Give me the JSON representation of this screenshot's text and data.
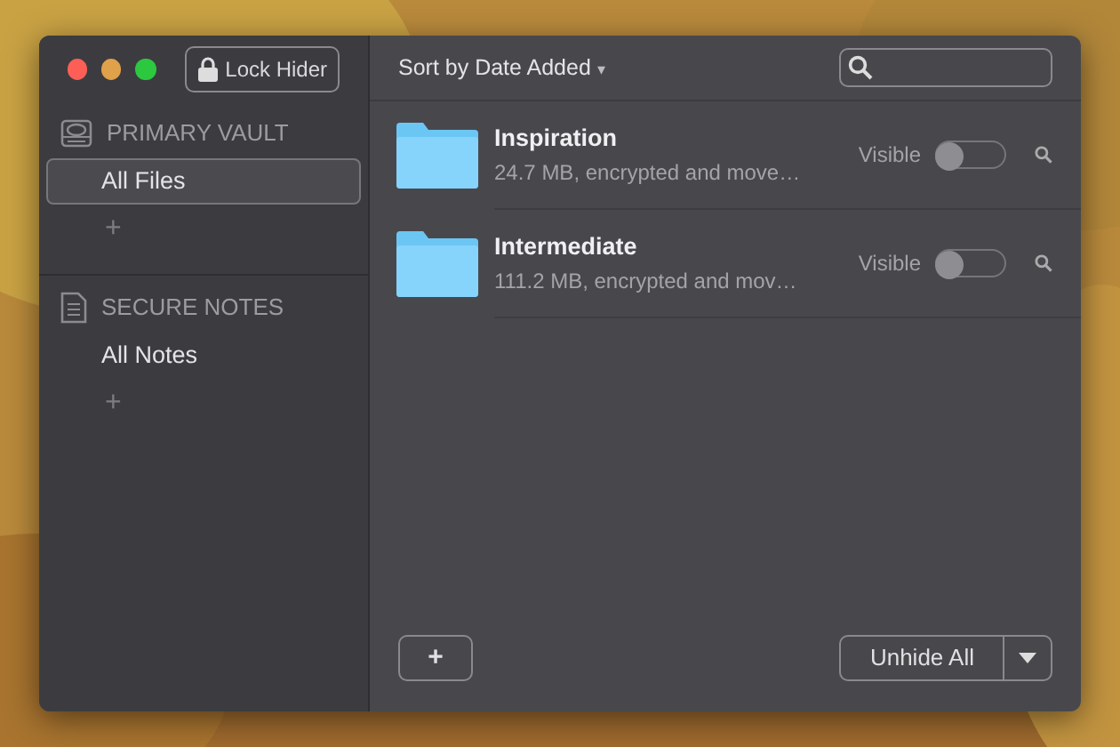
{
  "toolbar": {
    "lock_button": "Lock Hider",
    "sort_menu": "Sort by Date Added",
    "sort_caret": "▾"
  },
  "sidebar": {
    "sections": [
      {
        "kind": "vault",
        "title": "PRIMARY VAULT",
        "items": [
          {
            "label": "All Files",
            "selected": true
          }
        ],
        "add": "+"
      },
      {
        "kind": "notes",
        "title": "SECURE NOTES",
        "items": [
          {
            "label": "All Notes",
            "selected": false
          }
        ],
        "add": "+"
      }
    ]
  },
  "files": [
    {
      "name": "Inspiration",
      "detail": "24.7 MB, encrypted and move…",
      "status": "Visible",
      "on": false
    },
    {
      "name": "Intermediate",
      "detail": "111.2 MB, encrypted and mov…",
      "status": "Visible",
      "on": false
    }
  ],
  "footer": {
    "add_button": "+",
    "unhide_button": "Unhide All"
  }
}
